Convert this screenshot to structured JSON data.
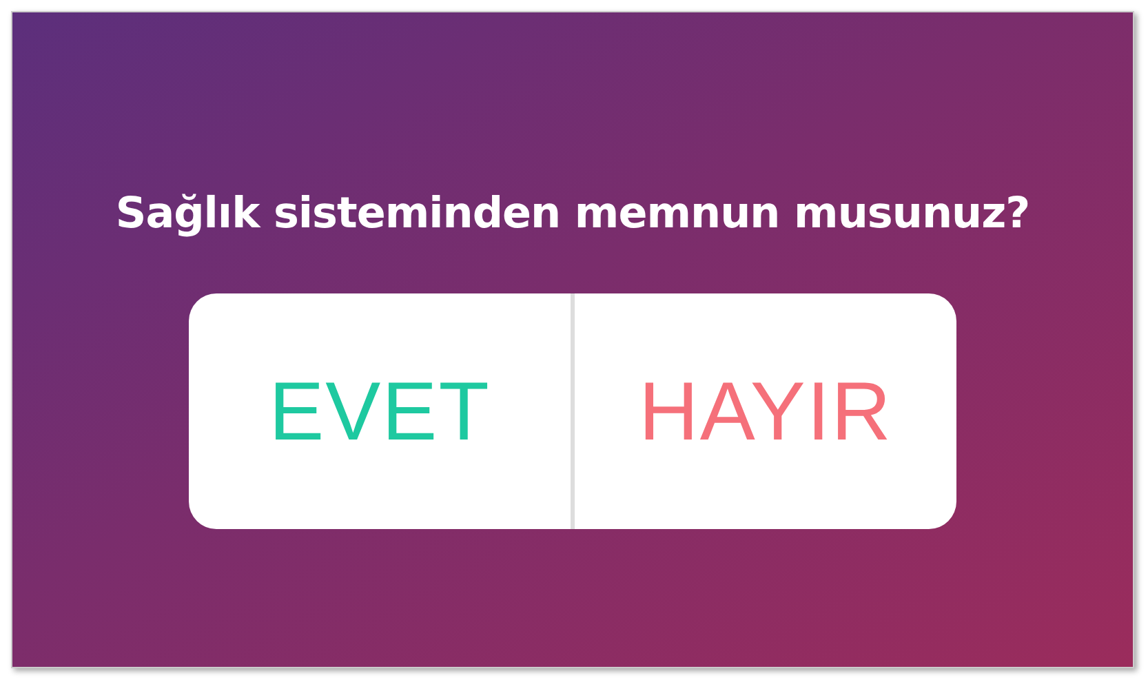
{
  "question": "Sağlık sisteminden memnun musunuz?",
  "options": [
    {
      "label": "EVET",
      "color": "#1ec9a0"
    },
    {
      "label": "HAYIR",
      "color": "#f5707a"
    }
  ]
}
